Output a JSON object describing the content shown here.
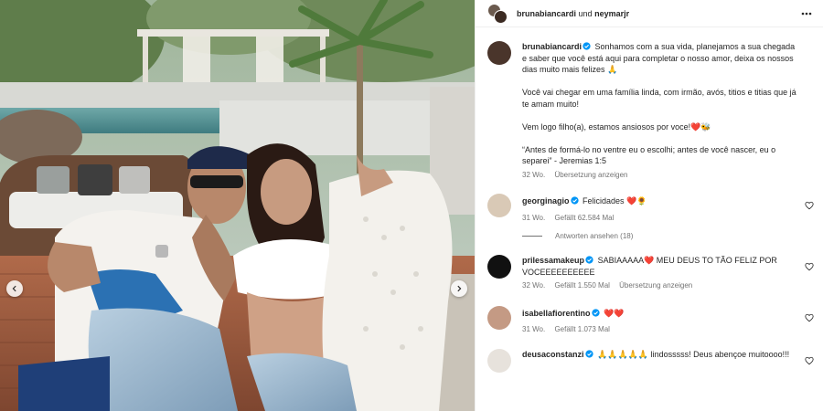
{
  "header": {
    "user1": "brunabiancardi",
    "conjunction": "und",
    "user2": "neymarjr"
  },
  "caption": {
    "username": "brunabiancardi",
    "paragraphs": [
      "Sonhamos com a sua vida, planejamos a sua chegada e saber que você está aqui para completar o nosso amor, deixa os nossos dias muito mais felizes 🙏",
      "Você vai chegar em uma família linda, com irmão, avós, titios e titias que já te amam muito!",
      "Vem logo filho(a), estamos ansiosos por voce!❤️🐝",
      "“Antes de formá-lo no ventre eu o escolhi; antes de você nascer, eu o separei” - Jeremias 1:5"
    ],
    "time": "32 Wo.",
    "translate": "Übersetzung anzeigen"
  },
  "comments": [
    {
      "username": "georginagio",
      "verified": true,
      "text": "Felicidades ❤️🌻",
      "time": "31 Wo.",
      "likes": "Gefällt 62.584 Mal",
      "replies": "Antworten ansehen (18)"
    },
    {
      "username": "prilessamakeup",
      "verified": true,
      "text": "SABIAAAAA❤️ MEU DEUS TO TÃO FELIZ POR VOCEEEEEEEEEE",
      "time": "32 Wo.",
      "likes": "Gefällt 1.550 Mal",
      "translate": "Übersetzung anzeigen"
    },
    {
      "username": "isabellafiorentino",
      "verified": true,
      "text": "❤️❤️",
      "time": "31 Wo.",
      "likes": "Gefällt 1.073 Mal"
    },
    {
      "username": "deusaconstanzi",
      "verified": true,
      "text": "🙏🙏🙏🙏🙏 lindosssss! Deus abençoe muitoooo!!!"
    }
  ],
  "colors": {
    "verified": "#0095f6",
    "heart": "#ed4956",
    "muted": "#737373"
  }
}
